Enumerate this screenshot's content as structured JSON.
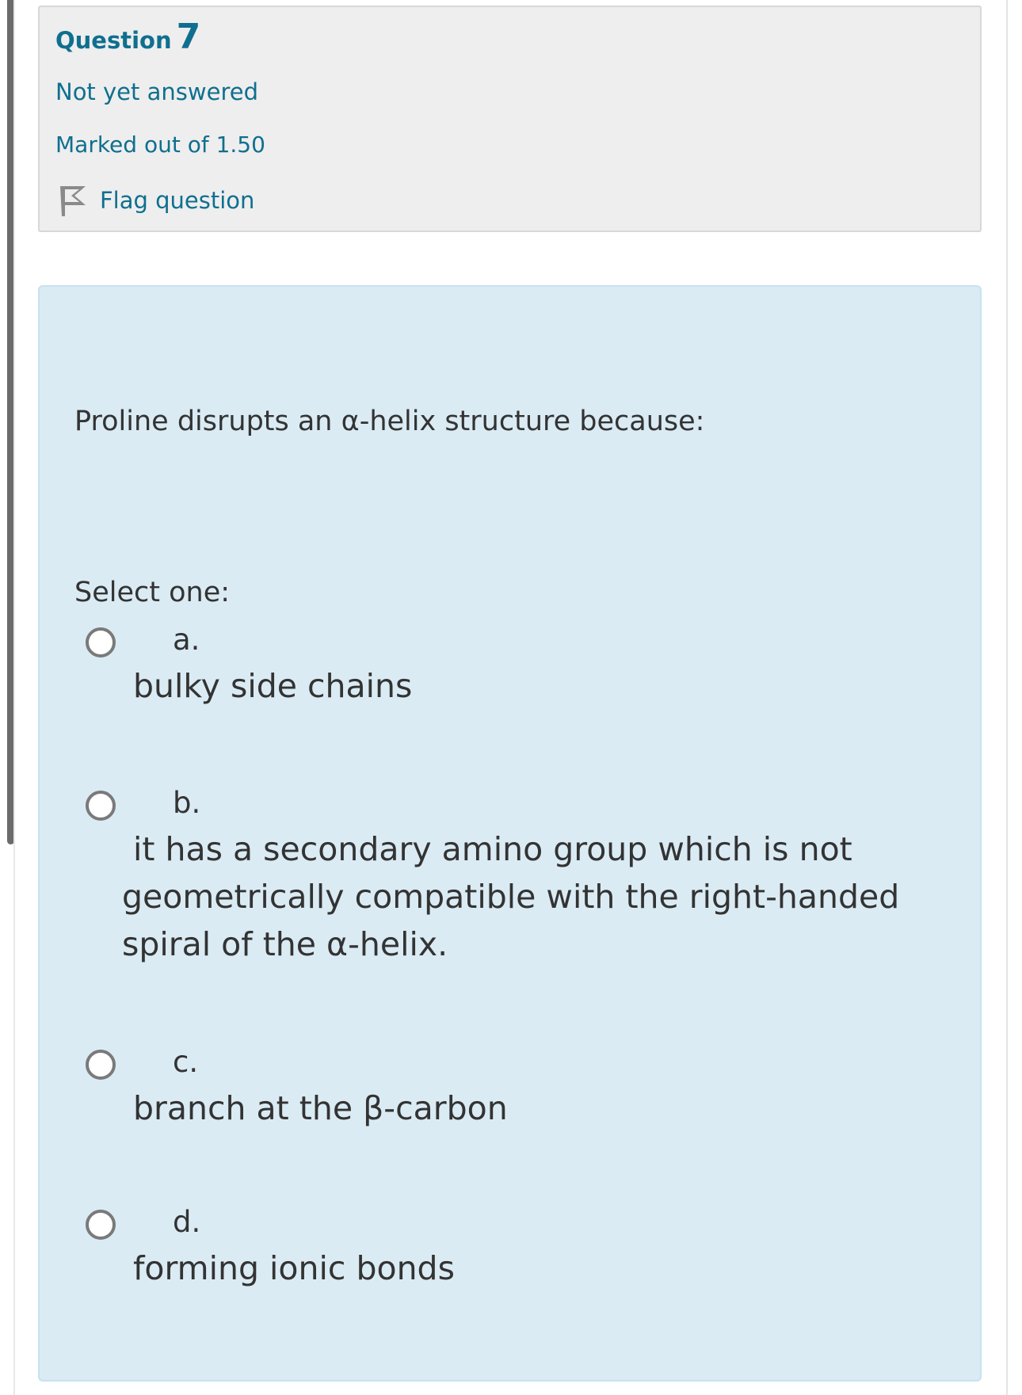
{
  "question": {
    "label": "Question",
    "number": "7",
    "state": "Not yet answered",
    "grade": "Marked out of 1.50",
    "flag_label": "Flag question"
  },
  "content": {
    "question_text": "Proline disrupts an α-helix structure because:",
    "select_prompt": "Select one:",
    "options": [
      {
        "letter": "a.",
        "text": "bulky side chains",
        "selected": false
      },
      {
        "letter": "b.",
        "text": "it has a secondary amino group which is not geometrically compatible with the right-handed spiral of the α-helix.",
        "selected": false
      },
      {
        "letter": "c.",
        "text": "branch at the β-carbon",
        "selected": false
      },
      {
        "letter": "d.",
        "text": "forming ionic bonds",
        "selected": false
      }
    ]
  },
  "colors": {
    "accent": "#0f6f8f",
    "info_bg": "#eeeeee",
    "content_bg": "#daebf4",
    "text": "#333333"
  },
  "icons": {
    "flag": "flag-icon",
    "radio": "radio-unchecked"
  }
}
